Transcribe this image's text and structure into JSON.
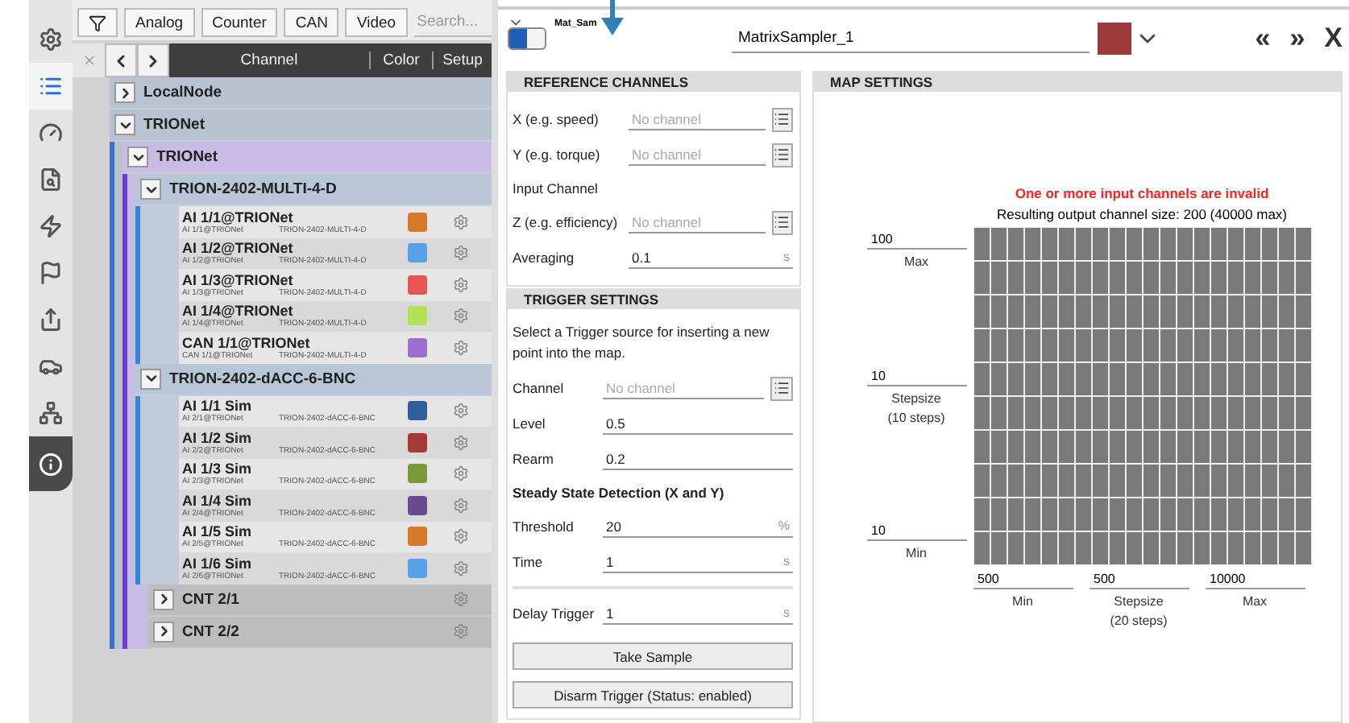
{
  "sidebar": {
    "items": [
      {
        "selected": false,
        "highlighted": false
      },
      {
        "selected": true,
        "highlighted": false
      },
      {
        "selected": false,
        "highlighted": false
      },
      {
        "selected": false,
        "highlighted": false
      },
      {
        "selected": false,
        "highlighted": false
      },
      {
        "selected": false,
        "highlighted": false
      },
      {
        "selected": false,
        "highlighted": false
      },
      {
        "selected": false,
        "highlighted": false
      },
      {
        "selected": false,
        "highlighted": false
      },
      {
        "selected": false,
        "highlighted": true
      }
    ]
  },
  "filter_bar": {
    "buttons": [
      "Analog",
      "Counter",
      "CAN",
      "Video"
    ],
    "search": {
      "placeholder": "Search..."
    }
  },
  "channel_list": {
    "columns": [
      "Channel",
      "Color",
      "Setup"
    ],
    "tree": [
      {
        "kind": "group",
        "label": "LocalNode",
        "expanded": false
      },
      {
        "kind": "group",
        "label": "TRIONet",
        "expanded": true,
        "children": [
          {
            "kind": "group",
            "label": "TRIONet",
            "expanded": true,
            "children": [
              {
                "kind": "group",
                "label": "TRION-2402-MULTI-4-D",
                "expanded": true,
                "children": [
                  {
                    "kind": "channel",
                    "name": "AI 1/1@TRIONet",
                    "sub": "AI 1/1@TRIONet",
                    "device": "TRION-2402-MULTI-4-D",
                    "color": "#d97a2b"
                  },
                  {
                    "kind": "channel",
                    "name": "AI 1/2@TRIONet",
                    "sub": "AI 1/2@TRIONet",
                    "device": "TRION-2402-MULTI-4-D",
                    "color": "#5aa0e8"
                  },
                  {
                    "kind": "channel",
                    "name": "AI 1/3@TRIONet",
                    "sub": "AI 1/3@TRIONet",
                    "device": "TRION-2402-MULTI-4-D",
                    "color": "#e85555"
                  },
                  {
                    "kind": "channel",
                    "name": "AI 1/4@TRIONet",
                    "sub": "AI 1/4@TRIONet",
                    "device": "TRION-2402-MULTI-4-D",
                    "color": "#b4e055"
                  },
                  {
                    "kind": "channel",
                    "name": "CAN 1/1@TRIONet",
                    "sub": "CAN 1/1@TRIONet",
                    "device": "TRION-2402-MULTI-4-D",
                    "color": "#9b6fcc"
                  }
                ]
              },
              {
                "kind": "group",
                "label": "TRION-2402-dACC-6-BNC",
                "expanded": true,
                "children": [
                  {
                    "kind": "channel",
                    "name": "AI 1/1 Sim",
                    "sub": "AI 2/1@TRIONet",
                    "device": "TRION-2402-dACC-6-BNC",
                    "color": "#2f5f9a"
                  },
                  {
                    "kind": "channel",
                    "name": "AI 1/2 Sim",
                    "sub": "AI 2/2@TRIONet",
                    "device": "TRION-2402-dACC-6-BNC",
                    "color": "#a33a35"
                  },
                  {
                    "kind": "channel",
                    "name": "AI 1/3 Sim",
                    "sub": "AI 2/3@TRIONet",
                    "device": "TRION-2402-dACC-6-BNC",
                    "color": "#7a9a3a"
                  },
                  {
                    "kind": "channel",
                    "name": "AI 1/4 Sim",
                    "sub": "AI 2/4@TRIONet",
                    "device": "TRION-2402-dACC-6-BNC",
                    "color": "#6a4a90"
                  },
                  {
                    "kind": "channel",
                    "name": "AI 1/5 Sim",
                    "sub": "AI 2/5@TRIONet",
                    "device": "TRION-2402-dACC-6-BNC",
                    "color": "#d97a2b"
                  },
                  {
                    "kind": "channel",
                    "name": "AI 1/6 Sim",
                    "sub": "AI 2/6@TRIONet",
                    "device": "TRION-2402-dACC-6-BNC",
                    "color": "#5aa0e8"
                  }
                ]
              },
              {
                "kind": "counter",
                "label": "CNT 2/1",
                "expanded": false
              },
              {
                "kind": "counter",
                "label": "CNT 2/2",
                "expanded": false
              }
            ]
          }
        ]
      }
    ]
  },
  "matrix_sampler": {
    "header": {
      "enabled": true,
      "short_name": "Mat_Sam",
      "name": "MatrixSampler_1",
      "color": "#9b3a3a",
      "nav": [
        "«",
        "»",
        "X"
      ]
    },
    "reference_channels": {
      "title": "REFERENCE CHANNELS",
      "rows": [
        {
          "kind": "channel",
          "label": "X (e.g. speed)",
          "placeholder": "No channel"
        },
        {
          "kind": "channel",
          "label": "Y (e.g. torque)",
          "placeholder": "No channel"
        },
        {
          "kind": "subheading",
          "label": "Input Channel"
        },
        {
          "kind": "channel",
          "label": "Z (e.g. efficiency)",
          "placeholder": "No channel"
        },
        {
          "kind": "value",
          "label": "Averaging",
          "value": "0.1",
          "unit": "s"
        }
      ]
    },
    "trigger_settings": {
      "title": "TRIGGER SETTINGS",
      "description": "Select a Trigger source for inserting a new point into the map.",
      "rows": [
        {
          "kind": "channel",
          "label": "Channel",
          "placeholder": "No channel"
        },
        {
          "kind": "value",
          "label": "Level",
          "value": "0.5"
        },
        {
          "kind": "value",
          "label": "Rearm",
          "value": "0.2"
        },
        {
          "kind": "heading",
          "label": "Steady State Detection (X and Y)"
        },
        {
          "kind": "value",
          "label": "Threshold",
          "value": "20",
          "unit": "%"
        },
        {
          "kind": "value",
          "label": "Time",
          "value": "1",
          "unit": "s"
        },
        {
          "kind": "divider"
        },
        {
          "kind": "value",
          "label": "Delay Trigger",
          "value": "1",
          "unit": "s"
        }
      ],
      "buttons": [
        "Take Sample",
        "Disarm Trigger (Status: enabled)"
      ]
    },
    "map_settings": {
      "title": "MAP SETTINGS",
      "error": "One or more input channels are invalid",
      "size_text": "Resulting output channel size: 200 (40000 max)",
      "y_axis": [
        {
          "value": "100",
          "label": "Max"
        },
        {
          "value": "10",
          "label": "Stepsize",
          "note": "(10 steps)"
        },
        {
          "value": "10",
          "label": "Min"
        }
      ],
      "x_axis": [
        {
          "value": "500",
          "label": "Min"
        },
        {
          "value": "500",
          "label": "Stepsize",
          "note": "(20 steps)"
        },
        {
          "value": "10000",
          "label": "Max"
        }
      ]
    }
  }
}
